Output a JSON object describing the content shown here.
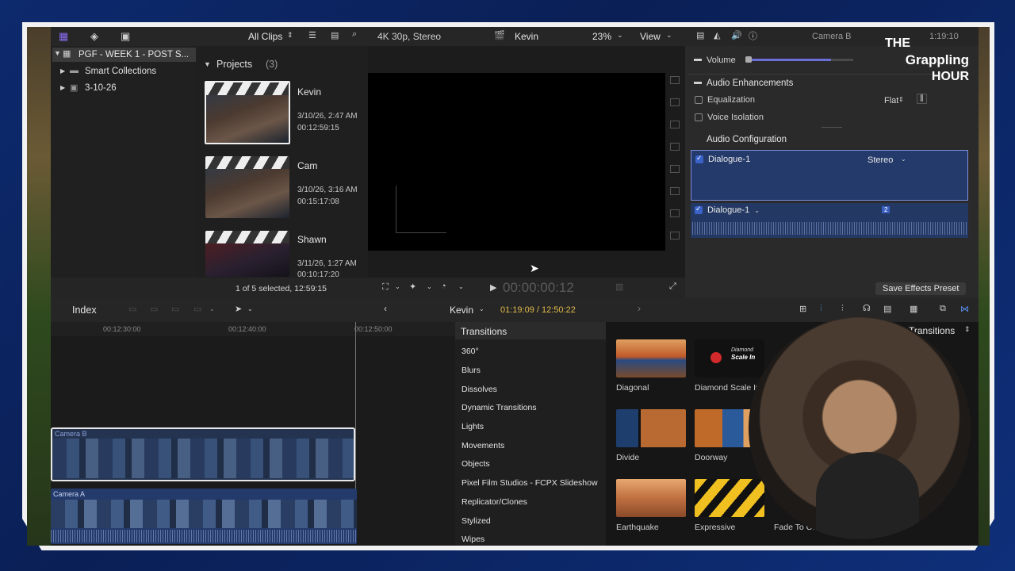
{
  "browser": {
    "library_name": "PGF - WEEK 1 - POST S...",
    "items": [
      "Smart Collections",
      "3-10-26"
    ],
    "filter_label": "All Clips",
    "projects_header": "Projects",
    "projects_count": "(3)",
    "projects": [
      {
        "name": "Kevin",
        "date": "3/10/26, 2:47 AM",
        "duration": "00:12:59:15"
      },
      {
        "name": "Cam",
        "date": "3/10/26, 3:16 AM",
        "duration": "00:15:17:08"
      },
      {
        "name": "Shawn",
        "date": "3/11/26, 1:27 AM",
        "duration": "00:10:17:20"
      }
    ],
    "selection_status": "1 of 5 selected, 12:59:15"
  },
  "viewer": {
    "format": "4K 30p, Stereo",
    "project_name": "Kevin",
    "zoom": "23%",
    "view_label": "View",
    "timecode": "00:00:00:12"
  },
  "inspector": {
    "clip_name": "Camera B",
    "timecode": "1:19:10",
    "volume_label": "Volume",
    "enhancements_label": "Audio Enhancements",
    "equalization_label": "Equalization",
    "equalization_value": "Flat",
    "voice_isolation_label": "Voice Isolation",
    "configuration_label": "Audio Configuration",
    "component_1": "Dialogue-1",
    "component_1_mode": "Stereo",
    "component_2": "Dialogue-1",
    "component_2_badge": "2",
    "save_preset_label": "Save Effects Preset"
  },
  "overlay": {
    "brand_line1": "THE",
    "brand_line2": "Grappling",
    "brand_line3": "HOUR"
  },
  "timeline": {
    "index_label": "Index",
    "project_name": "Kevin",
    "position": "01:19:09 / 12:50:22",
    "ruler": [
      "00:12:30:00",
      "00:12:40:00",
      "00:12:50:00"
    ],
    "track_b_label": "Camera B",
    "track_a_label": "Camera A"
  },
  "transitions": {
    "header": "Transitions",
    "popup_label": "Transitions",
    "categories": [
      "360°",
      "Blurs",
      "Dissolves",
      "Dynamic Transitions",
      "Lights",
      "Movements",
      "Objects",
      "Pixel Film Studios - FCPX Slideshow",
      "Replicator/Clones",
      "Stylized",
      "Wipes"
    ],
    "tiles": [
      "Diagonal",
      "Diamond Scale In",
      "Divide",
      "Doorway",
      "Earthquake",
      "Expressive",
      "Fade To Color"
    ],
    "tile_overlay_line1": "Diamond",
    "tile_overlay_line2": "Scale In"
  }
}
